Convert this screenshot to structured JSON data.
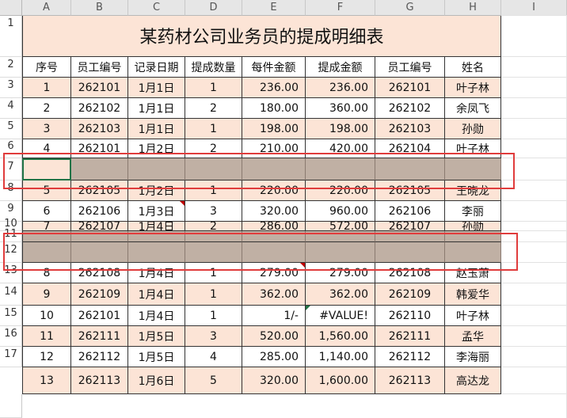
{
  "columns": [
    "A",
    "B",
    "C",
    "D",
    "E",
    "F",
    "G",
    "H",
    "I"
  ],
  "row_numbers": [
    "1",
    "2",
    "3",
    "4",
    "5",
    "6",
    "7",
    "8",
    "9",
    "10",
    "11",
    "12",
    "13",
    "14",
    "15",
    "16",
    "17"
  ],
  "title": "某药材公司业务员的提成明细表",
  "headers": [
    "序号",
    "员工编号",
    "记录日期",
    "提成数量",
    "每件金额",
    "提成金额",
    "员工编号",
    "姓名"
  ],
  "rows": [
    [
      "1",
      "262101",
      "1月1日",
      "1",
      "236.00",
      "236.00",
      "262101",
      "叶子林"
    ],
    [
      "2",
      "262102",
      "1月1日",
      "2",
      "180.00",
      "360.00",
      "262102",
      "余凤飞"
    ],
    [
      "3",
      "262103",
      "1月1日",
      "1",
      "198.00",
      "198.00",
      "262103",
      "孙勋"
    ],
    [
      "4",
      "262101",
      "1月2日",
      "2",
      "210.00",
      "420.00",
      "262104",
      "叶子林"
    ],
    [
      "",
      "",
      "",
      "",
      "",
      "",
      "",
      ""
    ],
    [
      "5",
      "262105",
      "1月2日",
      "1",
      "220.00",
      "220.00",
      "262105",
      "王晓龙"
    ],
    [
      "6",
      "262106",
      "1月3日",
      "3",
      "320.00",
      "960.00",
      "262106",
      "李丽"
    ],
    [
      "7",
      "262107",
      "1月4日",
      "2",
      "286.00",
      "572.00",
      "262107",
      "孙勋"
    ],
    [
      "",
      "",
      "",
      "",
      "",
      "",
      "",
      ""
    ],
    [
      "",
      "",
      "",
      "",
      "",
      "",
      "",
      ""
    ],
    [
      "8",
      "262108",
      "1月4日",
      "1",
      "279.00",
      "279.00",
      "262108",
      "赵玉萧"
    ],
    [
      "9",
      "262109",
      "1月4日",
      "1",
      "362.00",
      "362.00",
      "262109",
      "韩爱华"
    ],
    [
      "10",
      "262101",
      "1月4日",
      "1",
      "1/-",
      "#VALUE!",
      "262110",
      "叶子林"
    ],
    [
      "11",
      "262111",
      "1月5日",
      "3",
      "520.00",
      "1,560.00",
      "262111",
      "孟华"
    ],
    [
      "12",
      "262112",
      "1月5日",
      "4",
      "285.00",
      "1,140.00",
      "262112",
      "李海丽"
    ],
    [
      "13",
      "262113",
      "1月6日",
      "5",
      "320.00",
      "1,600.00",
      "262113",
      "高达龙"
    ]
  ],
  "colors": {
    "band": "#fce4d6",
    "gray_row": "#c0b0a4",
    "highlight_box": "#e03c3c",
    "selection": "#217346"
  }
}
